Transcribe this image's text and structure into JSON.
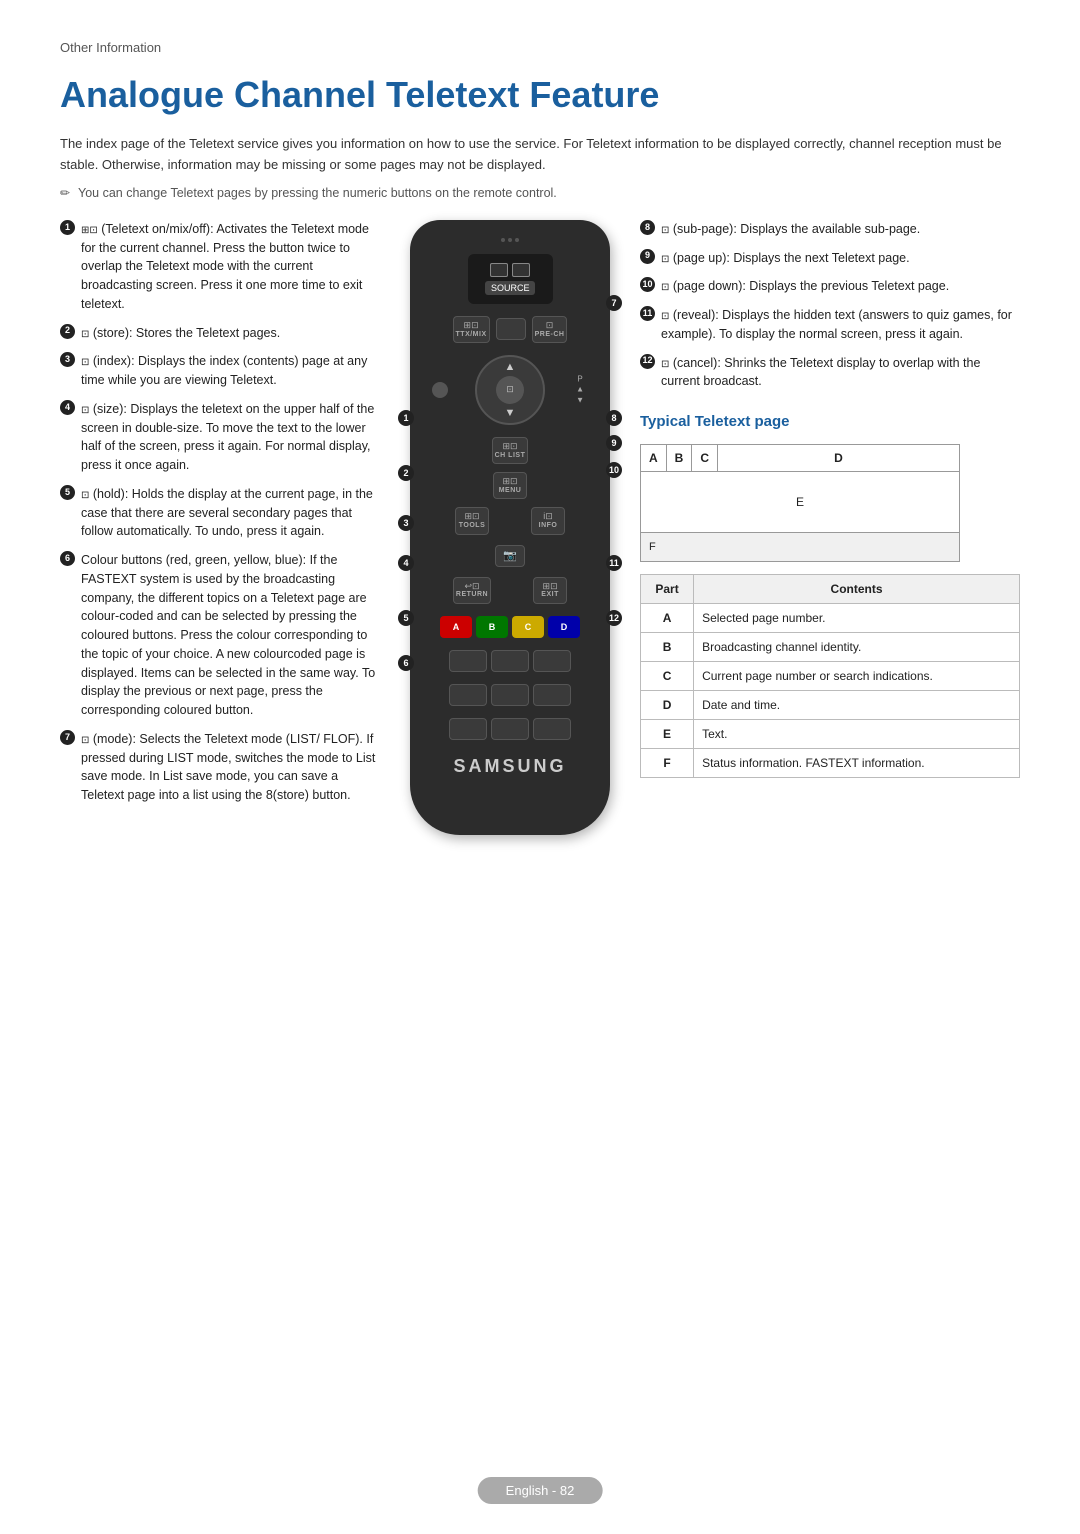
{
  "breadcrumb": "Other Information",
  "title": "Analogue Channel Teletext Feature",
  "intro": "The index page of the Teletext service gives you information on how to use the service. For Teletext information to be displayed correctly, channel reception must be stable. Otherwise, information may be missing or some pages may not be displayed.",
  "note": "You can change Teletext pages by pressing the numeric buttons on the remote control.",
  "left_items": [
    {
      "num": "1",
      "icon": "⊡⊡",
      "text": "(Teletext on/mix/off): Activates the Teletext mode for the current channel. Press the button twice to overlap the Teletext mode with the current broadcasting screen. Press it one more time to exit teletext."
    },
    {
      "num": "2",
      "icon": "⊡",
      "text": "(store): Stores the Teletext pages."
    },
    {
      "num": "3",
      "icon": "⊡",
      "text": "(index): Displays the index (contents) page at any time while you are viewing Teletext."
    },
    {
      "num": "4",
      "icon": "⊡",
      "text": "(size): Displays the teletext on the upper half of the screen in double-size. To move the text to the lower half of the screen, press it again. For normal display, press it once again."
    },
    {
      "num": "5",
      "icon": "⊡",
      "text": "(hold): Holds the display at the current page, in the case that there are several secondary pages that follow automatically. To undo, press it again."
    },
    {
      "num": "6",
      "icon": "",
      "text": "Colour buttons (red, green, yellow, blue): If the FASTEXT system is used by the broadcasting company, the different topics on a Teletext page are colour-coded and can be selected by pressing the coloured buttons. Press the colour corresponding to the topic of your choice. A new colourcoded page is displayed. Items can be selected in the same way. To display the previous or next page, press the corresponding coloured button."
    },
    {
      "num": "7",
      "icon": "⊡",
      "text": "(mode): Selects the Teletext mode (LIST/ FLOF). If pressed during LIST mode, switches the mode to List save mode. In List save mode, you can save a Teletext page into a list using the 8(store) button."
    }
  ],
  "right_items": [
    {
      "num": "8",
      "icon": "⊡",
      "text": "(sub-page): Displays the available sub-page."
    },
    {
      "num": "9",
      "icon": "⊡",
      "text": "(page up): Displays the next Teletext page."
    },
    {
      "num": "10",
      "icon": "⊡",
      "text": "(page down): Displays the previous Teletext page."
    },
    {
      "num": "11",
      "icon": "⊡",
      "text": "(reveal): Displays the hidden text (answers to quiz games, for example). To display the normal screen, press it again."
    },
    {
      "num": "12",
      "icon": "⊡",
      "text": "(cancel): Shrinks the Teletext display to overlap with the current broadcast."
    }
  ],
  "teletext_title": "Typical Teletext page",
  "teletext_cols": [
    "A",
    "B",
    "C",
    "D"
  ],
  "teletext_e_label": "E",
  "teletext_f_label": "F",
  "table_headers": [
    "Part",
    "Contents"
  ],
  "table_rows": [
    [
      "A",
      "Selected page number."
    ],
    [
      "B",
      "Broadcasting channel identity."
    ],
    [
      "C",
      "Current page number or search indications."
    ],
    [
      "D",
      "Date and time."
    ],
    [
      "E",
      "Text."
    ],
    [
      "F",
      "Status information. FASTEXT information."
    ]
  ],
  "remote": {
    "source_label": "SOURCE",
    "ttxmix_label": "TTX/MIX",
    "prech_label": "PRE-CH",
    "chlist_label": "CH LIST",
    "menu_label": "MENU",
    "tools_label": "TOOLS",
    "info_label": "INFO",
    "return_label": "RETURN",
    "exit_label": "EXIT",
    "p_label": "P",
    "samsung_logo": "SAMSUNG",
    "color_buttons": [
      "A",
      "B",
      "C",
      "D"
    ],
    "color_values": [
      "#e00",
      "#090",
      "#dd0",
      "#00a"
    ]
  },
  "footer": "English - 82"
}
